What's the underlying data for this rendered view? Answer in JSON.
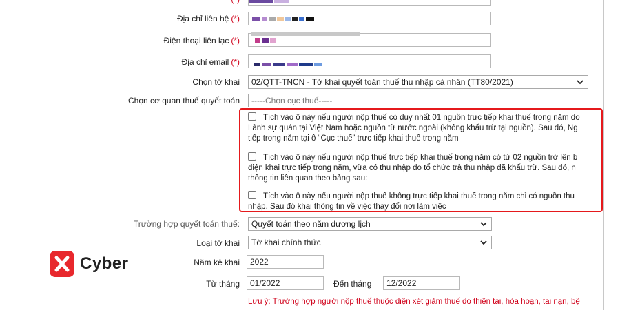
{
  "form": {
    "labels": {
      "contact_address": "Địa chỉ liên hệ",
      "phone": "Điện thoại liên lạc",
      "email": "Địa chỉ email",
      "declaration": "Chọn tờ khai",
      "tax_office": "Chọn cơ quan thuế quyết toán",
      "settlement_case": "Trường hợp quyết toán thuế:",
      "declaration_type": "Loại tờ khai",
      "year": "Năm kê khai",
      "from_month": "Từ tháng",
      "to_month": "Đến tháng"
    },
    "required_mark": "(*)",
    "declaration_value": "02/QTT-TNCN - Tờ khai quyết toán thuế thu nhập cá nhân (TT80/2021)",
    "tax_office_value": "-----Chọn cục thuế-----",
    "settlement_case_value": "Quyết toán theo năm dương lịch",
    "declaration_type_value": "Tờ khai chính thức",
    "year_value": "2022",
    "from_month_value": "01/2022",
    "to_month_value": "12/2022"
  },
  "options": [
    {
      "line1": "Tích vào ô này nếu người nộp thuế có duy nhất 01 nguồn trực tiếp khai thuế trong năm do",
      "line2": "Lãnh sự quán tại Việt Nam hoặc nguồn từ nước ngoài (không khấu trừ tại nguồn). Sau đó, Ng",
      "line3": "tiếp trong năm tại ô “Cục thuế” trực tiếp khai thuế trong năm"
    },
    {
      "line1": "Tích vào ô này nếu người nộp thuế trực tiếp khai thuế trong năm có từ 02 nguồn trở lên b",
      "line2": "diện khai trực tiếp trong năm, vừa có thu nhập do tổ chức trả thu nhập đã khấu trừ. Sau đó, n",
      "line3": "thông tin liên quan theo bảng sau:"
    },
    {
      "line1": "Tích vào ô này nếu người nộp thuế không trực tiếp khai thuế trong năm chỉ có nguồn thu",
      "line2": "nhập. Sau đó khai thông tin về việc thay đổi nơi làm việc"
    }
  ],
  "note": "Lưu ý: Trường hợp người nộp thuế thuộc diện xét giảm thuế do thiên tai, hỏa hoạn, tai nạn, bệ",
  "logo": {
    "text": "Cyber",
    "color": "#e8282d"
  },
  "colors": {
    "highlight": "#e5191c",
    "required": "#d0021b"
  },
  "icons": [
    "chevron-down-icon",
    "checkbox-icon",
    "cyber-logo-icon"
  ]
}
